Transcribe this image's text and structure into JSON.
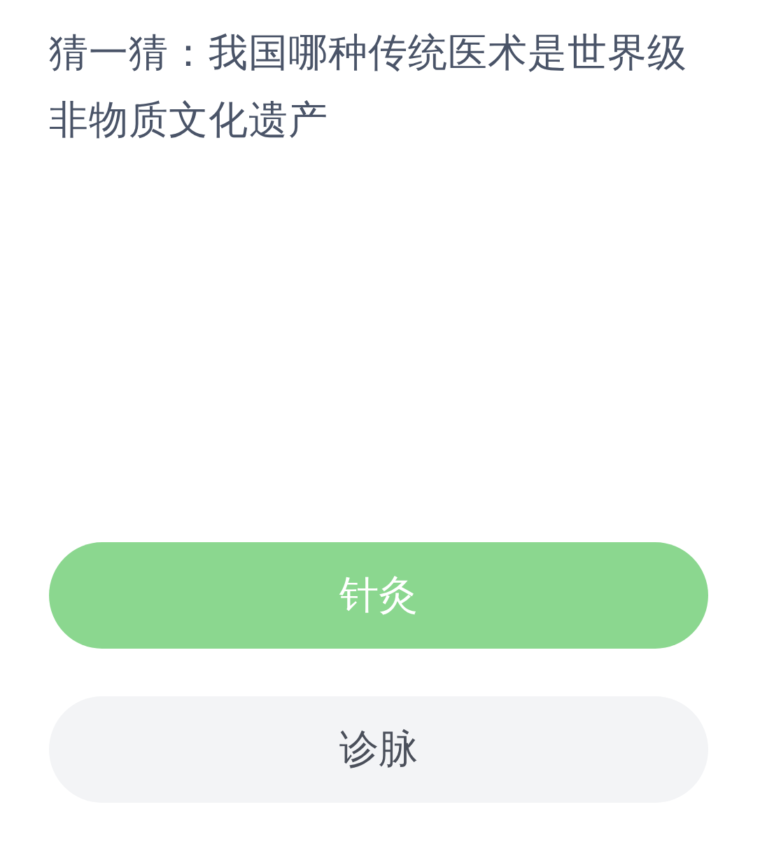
{
  "question": "猜一猜：我国哪种传统医术是世界级非物质文化遗产",
  "options": [
    {
      "label": "针灸",
      "selected": true
    },
    {
      "label": "诊脉",
      "selected": false
    }
  ]
}
